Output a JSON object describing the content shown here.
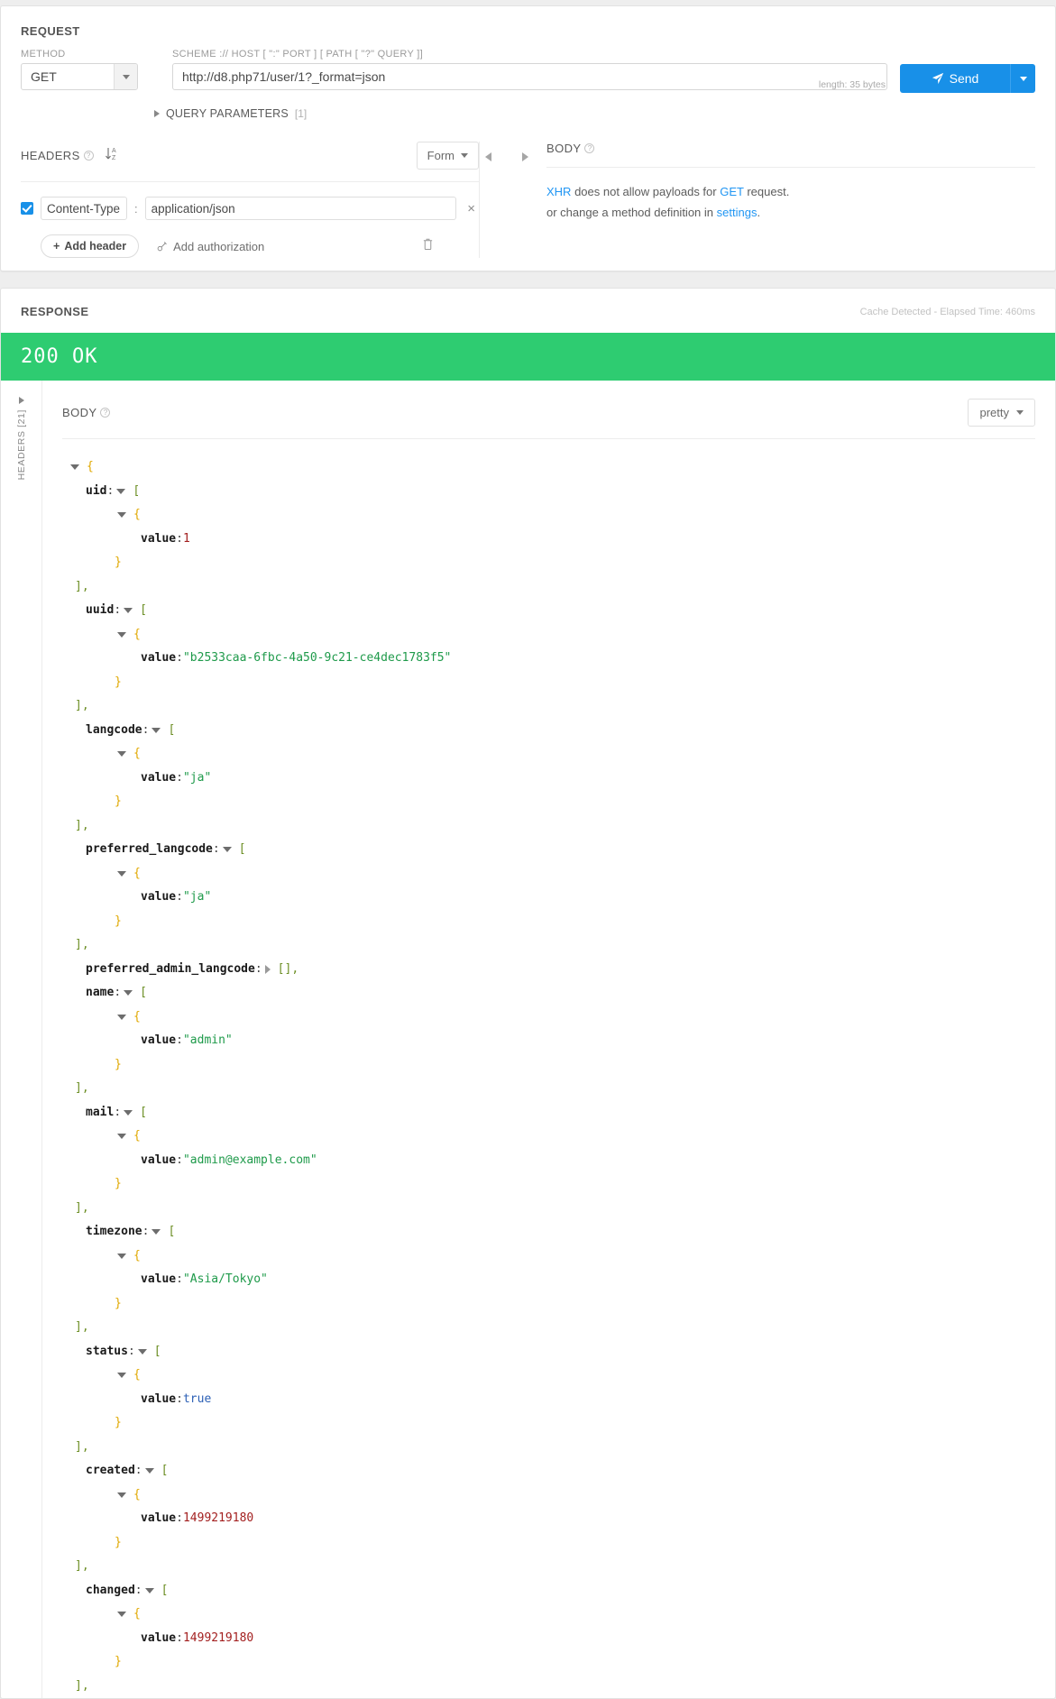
{
  "request": {
    "section_title": "REQUEST",
    "method_label": "METHOD",
    "method_value": "GET",
    "url_label": "SCHEME :// HOST [ \":\" PORT ] [ PATH [ \"?\" QUERY ]]",
    "url_value": "http://d8.php71/user/1?_format=json",
    "url_placeholder": "http://",
    "length_note": "length: 35 bytes",
    "send_label": "Send",
    "query_parameters_label": "QUERY PARAMETERS",
    "query_parameters_count": "[1]"
  },
  "headers": {
    "title": "HEADERS",
    "help": "?",
    "view_mode": "Form",
    "rows": [
      {
        "enabled": true,
        "key": "Content-Type",
        "separator": ":",
        "value": "application/json",
        "remove": "×"
      }
    ],
    "add_header_label": "Add header",
    "add_header_plus": "+",
    "add_authorization_label": "Add authorization"
  },
  "body_panel": {
    "title": "BODY",
    "help": "?",
    "note_part1": "XHR",
    "note_part2": " does not allow payloads for ",
    "note_part3": "GET",
    "note_part4": " request.",
    "note2_part1": "or change a method definition in ",
    "note2_part2": "settings",
    "note2_part3": "."
  },
  "response": {
    "section_title": "RESPONSE",
    "meta": "Cache Detected - Elapsed Time: 460ms",
    "status": "200 OK",
    "status_color": "#2ecc71",
    "side_label": "HEADERS [21]",
    "body_title": "BODY",
    "body_help": "?",
    "format_value": "pretty"
  },
  "json_body": {
    "open_brace": "{",
    "close_bracket_comma": "],",
    "close_brace": "}",
    "open_bracket": "[",
    "colon": ":",
    "value_key": "value",
    "entries": [
      {
        "key": "uid",
        "value": "1",
        "vtype": "num"
      },
      {
        "key": "uuid",
        "value": "\"b2533caa-6fbc-4a50-9c21-ce4dec1783f5\"",
        "vtype": "str"
      },
      {
        "key": "langcode",
        "value": "\"ja\"",
        "vtype": "str"
      },
      {
        "key": "preferred_langcode",
        "value": "\"ja\"",
        "vtype": "str"
      },
      {
        "key": "preferred_admin_langcode",
        "value": "[],",
        "vtype": "empty"
      },
      {
        "key": "name",
        "value": "\"admin\"",
        "vtype": "str"
      },
      {
        "key": "mail",
        "value": "\"admin@example.com\"",
        "vtype": "str"
      },
      {
        "key": "timezone",
        "value": "\"Asia/Tokyo\"",
        "vtype": "str"
      },
      {
        "key": "status",
        "value": "true",
        "vtype": "bool"
      },
      {
        "key": "created",
        "value": "1499219180",
        "vtype": "num"
      },
      {
        "key": "changed",
        "value": "1499219180",
        "vtype": "num"
      }
    ]
  }
}
